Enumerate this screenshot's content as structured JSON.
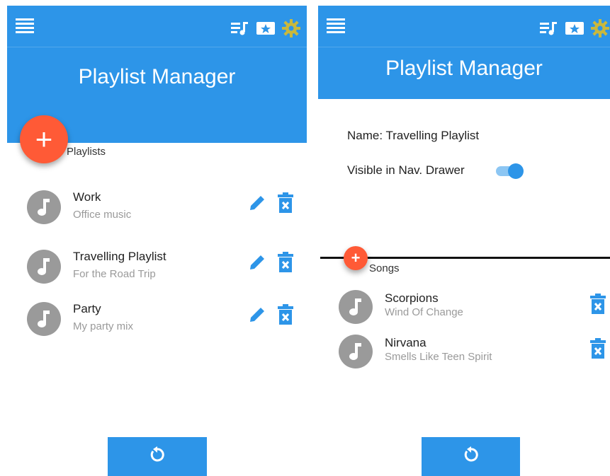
{
  "colors": {
    "primary": "#2d95e8",
    "accent_fab": "#ff5a36",
    "gear": "#c9b83d",
    "avatar": "#9a9a9a",
    "text": "#222222",
    "subtext": "#9a9a9a"
  },
  "left_screen": {
    "app_title": "Playlist Manager",
    "section_label": "Playlists",
    "fab_symbol": "+",
    "playlists": [
      {
        "title": "Work",
        "subtitle": "Office music"
      },
      {
        "title": "Travelling Playlist",
        "subtitle": "For the Road Trip"
      },
      {
        "title": "Party",
        "subtitle": "My party mix"
      }
    ],
    "icons": [
      "menu-icon",
      "playlist-icon",
      "star-ticket-icon",
      "gear-icon",
      "music-note-icon",
      "edit-pencil-icon",
      "delete-trash-icon",
      "refresh-icon"
    ]
  },
  "right_screen": {
    "app_title": "Playlist Manager",
    "name_line": "Name: Travelling Playlist",
    "visible_label": "Visible in Nav. Drawer",
    "visible_toggle_on": true,
    "section_label": "Songs",
    "fab_symbol": "+",
    "songs": [
      {
        "title": "Scorpions",
        "subtitle": "Wind Of Change"
      },
      {
        "title": "Nirvana",
        "subtitle": "Smells Like Teen Spirit"
      }
    ]
  }
}
